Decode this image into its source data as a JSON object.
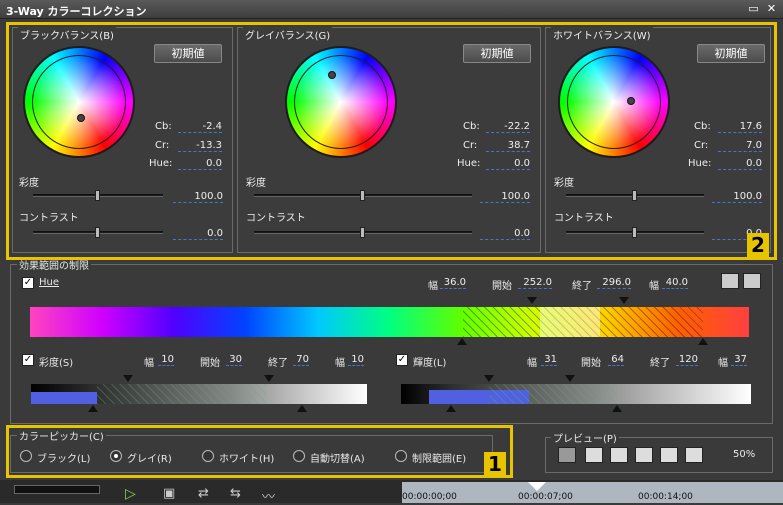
{
  "window": {
    "title": "3-Way カラーコレクション",
    "restore_glyph": "▭",
    "close_glyph": "✕"
  },
  "panels": [
    {
      "title": "ブラックバランス(B)",
      "reset": "初期値",
      "cb_label": "Cb:",
      "cb": "-2.4",
      "cr_label": "Cr:",
      "cr": "-13.3",
      "hue_label": "Hue:",
      "hue": "0.0",
      "sat_label": "彩度",
      "sat": "100.0",
      "contrast_label": "コントラスト",
      "contrast": "0.0"
    },
    {
      "title": "グレイバランス(G)",
      "reset": "初期値",
      "cb_label": "Cb:",
      "cb": "-22.2",
      "cr_label": "Cr:",
      "cr": "38.7",
      "hue_label": "Hue:",
      "hue": "0.0",
      "sat_label": "彩度",
      "sat": "100.0",
      "contrast_label": "コントラスト",
      "contrast": "0.0"
    },
    {
      "title": "ホワイトバランス(W)",
      "reset": "初期値",
      "cb_label": "Cb:",
      "cb": "17.6",
      "cr_label": "Cr:",
      "cr": "7.0",
      "hue_label": "Hue:",
      "hue": "0.0",
      "sat_label": "彩度",
      "sat": "100.0",
      "contrast_label": "コントラスト",
      "contrast": "0.0"
    }
  ],
  "limit": {
    "title": "効果範囲の制限",
    "hue": {
      "label": "Hue",
      "checked": true,
      "width_label": "幅",
      "width": "36.0",
      "start_label": "開始",
      "start": "252.0",
      "end_label": "終了",
      "end": "296.0",
      "width2_label": "幅",
      "width2": "40.0"
    },
    "sat": {
      "label": "彩度(S)",
      "checked": true,
      "width_label": "幅",
      "width": "10",
      "start_label": "開始",
      "start": "30",
      "end_label": "終了",
      "end": "70",
      "width2_label": "幅",
      "width2": "10"
    },
    "lum": {
      "label": "輝度(L)",
      "checked": true,
      "width_label": "幅",
      "width": "31",
      "start_label": "開始",
      "start": "64",
      "end_label": "終了",
      "end": "120",
      "width2_label": "幅",
      "width2": "37"
    }
  },
  "picker": {
    "title": "カラーピッカー(C)",
    "options": [
      "ブラック(L)",
      "グレイ(R)",
      "ホワイト(H)",
      "自動切替(A)",
      "制限範囲(E)"
    ],
    "selected_index": 1
  },
  "preview": {
    "title": "プレビュー(P)",
    "zoom": "50%"
  },
  "timeline": {
    "t1": "00:00:00;00",
    "t2": "00:00:07;00",
    "t3": "00:00:14;00"
  },
  "badges": {
    "one": "1",
    "two": "2"
  },
  "colors": {
    "accent": "#e8c300",
    "dash": "#4a74c8"
  }
}
